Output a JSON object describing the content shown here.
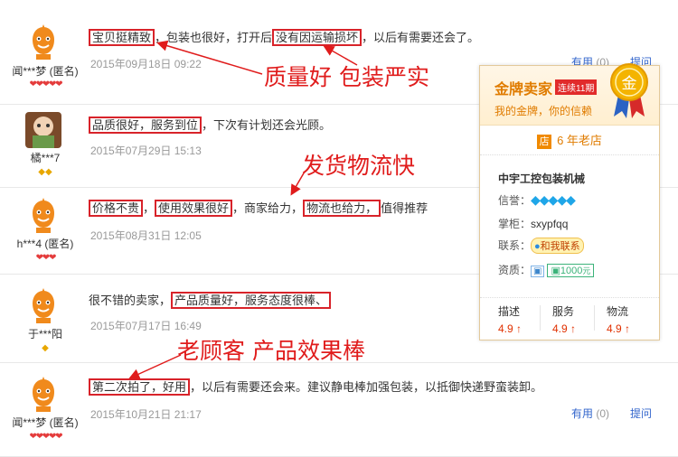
{
  "reviews": [
    {
      "user": "闻***梦 (匿名)",
      "badge": "hearts",
      "badge_count": 5,
      "date": "2015年09月18日 09:22",
      "parts": [
        {
          "t": "宝贝挺精致",
          "hl": true
        },
        {
          "t": "，包装也很好，打开后",
          "hl": false
        },
        {
          "t": "没有因运输损坏",
          "hl": true
        },
        {
          "t": "，以后有需要还会了。",
          "hl": false
        }
      ],
      "useful_label": "有用",
      "useful_count": "(0)",
      "reply_label": "提问"
    },
    {
      "user": "橘***7",
      "badge": "diamonds",
      "badge_count": 2,
      "date": "2015年07月29日 15:13",
      "parts": [
        {
          "t": "品质很好，服务到位",
          "hl": true
        },
        {
          "t": "，下次有计划还会光顾。",
          "hl": false
        }
      ]
    },
    {
      "user": "h***4 (匿名)",
      "badge": "hearts",
      "badge_count": 3,
      "date": "2015年08月31日 12:05",
      "parts": [
        {
          "t": "价格不贵",
          "hl": true
        },
        {
          "t": "，",
          "hl": false
        },
        {
          "t": "使用效果很好",
          "hl": true
        },
        {
          "t": "，商家给力，",
          "hl": false
        },
        {
          "t": "物流也给力，",
          "hl": true
        },
        {
          "t": "值得推荐",
          "hl": false
        }
      ]
    },
    {
      "user": "于***阳",
      "badge": "diamonds",
      "badge_count": 1,
      "date": "2015年07月17日 16:49",
      "parts": [
        {
          "t": "很不错的卖家，",
          "hl": false
        },
        {
          "t": "产品质量好，服务态度很棒、",
          "hl": true
        }
      ]
    },
    {
      "user": "闻***梦 (匿名)",
      "badge": "hearts",
      "badge_count": 5,
      "date": "2015年10月21日 21:17",
      "parts": [
        {
          "t": "第二次拍了，好用",
          "hl": true
        },
        {
          "t": "，以后有需要还会来。建议静电棒加强包装，以抵御快递野蛮装卸。",
          "hl": false
        }
      ],
      "useful_label": "有用",
      "useful_count": "(0)",
      "reply_label": "提问"
    }
  ],
  "annotations": {
    "a1": "质量好 包装严实",
    "a2": "发货物流快",
    "a3": "老顾客 产品效果棒"
  },
  "shop_card": {
    "title": "金牌卖家",
    "streak": "连续11期",
    "subtitle": "我的金牌，你的信赖",
    "medal_char": "金",
    "shop_icon": "店",
    "years": "6 年老店",
    "shop_name": "中宇工控包装机械",
    "credit_label": "信誉：",
    "owner_label": "掌柜：",
    "owner": "sxypfqq",
    "contact_label": "联系：",
    "contact_btn": "和我联系",
    "qual_label": "资质：",
    "deposit": "1000",
    "deposit_unit": "元",
    "scores": [
      {
        "label": "描述",
        "value": "4.9"
      },
      {
        "label": "服务",
        "value": "4.9"
      },
      {
        "label": "物流",
        "value": "4.9"
      }
    ]
  },
  "colors": {
    "accent_red": "#d8232a",
    "link_blue": "#3366cc",
    "gold": "#e07c00"
  },
  "icons": {
    "avatar": "orange-mascot-avatar",
    "heart": "heart-icon",
    "diamond": "diamond-icon",
    "gem": "blue-gem-icon",
    "up": "up-arrow-icon"
  }
}
